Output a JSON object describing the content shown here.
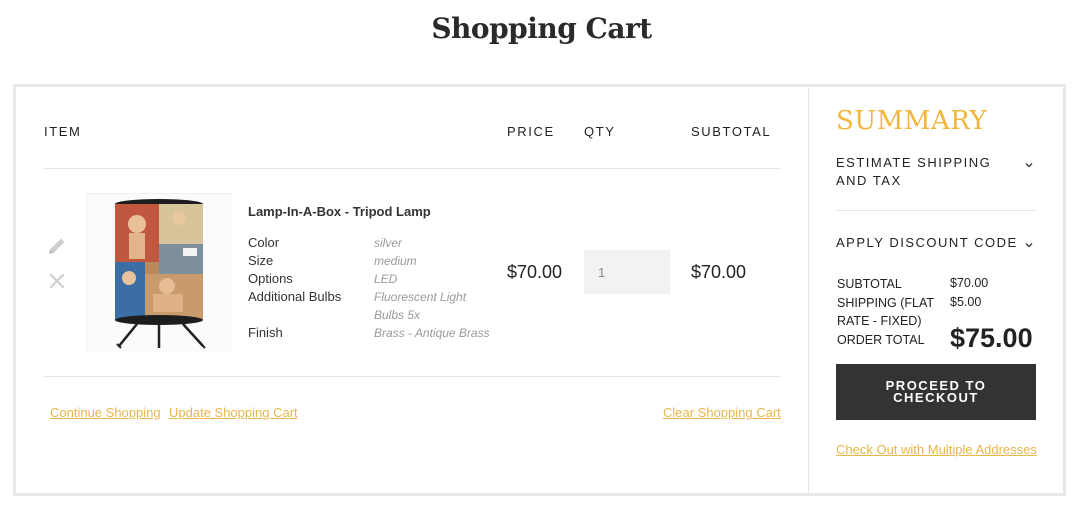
{
  "page": {
    "title": "Shopping Cart"
  },
  "cart": {
    "headers": {
      "item": "ITEM",
      "price": "PRICE",
      "qty": "QTY",
      "subtotal": "SUBTOTAL"
    },
    "item": {
      "name": "Lamp-In-A-Box - Tripod Lamp",
      "options": [
        {
          "label": "Color",
          "value": "silver"
        },
        {
          "label": "Size",
          "value": "medium"
        },
        {
          "label": "Options",
          "value": "LED"
        },
        {
          "label": "Additional Bulbs",
          "value": "Fluorescent Light"
        },
        {
          "label": "",
          "value": "Bulbs 5x"
        },
        {
          "label": "Finish",
          "value": "Brass - Antique Brass"
        }
      ],
      "price": "$70.00",
      "qty": "1",
      "subtotal": "$70.00",
      "image_icon": "tripod-lamp-product-image",
      "edit_icon": "pencil-icon",
      "remove_icon": "close-icon"
    },
    "links": {
      "continue": "Continue Shopping",
      "update": "Update Shopping Cart",
      "clear": "Clear Shopping Cart"
    }
  },
  "summary": {
    "title": "SUMMARY",
    "estimate_line1": "ESTIMATE SHIPPING",
    "estimate_line2": "AND TAX",
    "discount": "APPLY DISCOUNT CODE",
    "subtotal_label": "SUBTOTAL",
    "subtotal_value": "$70.00",
    "shipping_label_line1": "SHIPPING (FLAT",
    "shipping_label_line2": "RATE - FIXED)",
    "shipping_value": "$5.00",
    "order_total_label": "ORDER TOTAL",
    "order_total_value": "$75.00",
    "checkout_button": "PROCEED TO CHECKOUT",
    "multi_address_link": "Check Out with Multiple Addresses"
  },
  "colors": {
    "accent": "#f0b73c",
    "link": "#e8b64a",
    "button": "#333333"
  }
}
